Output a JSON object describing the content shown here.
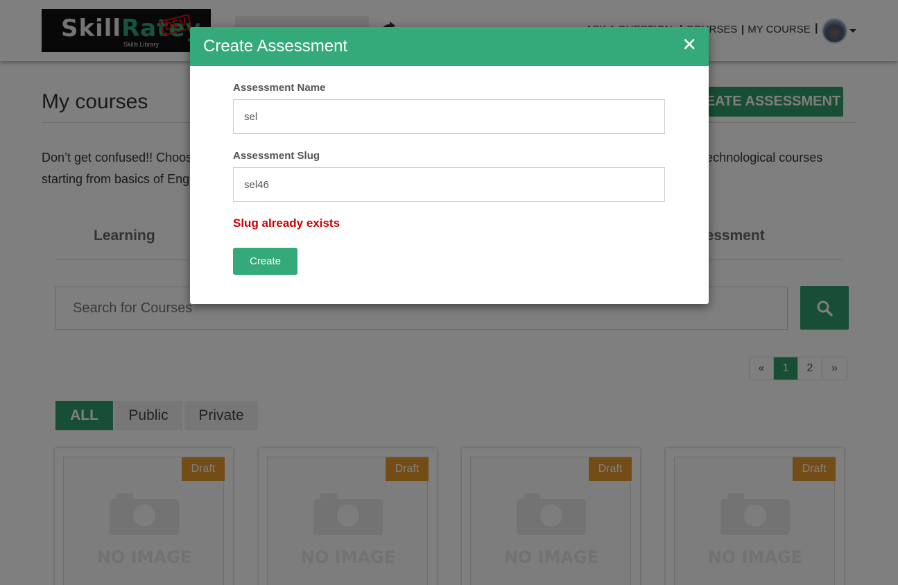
{
  "header": {
    "logo_text_a": "Skill",
    "logo_text_b": "Ratey",
    "logo_sub": "Skills Library",
    "logo_stamp": "DEV",
    "nav": {
      "ask_question": "ASK A QUESTION",
      "courses": "COURSES",
      "my_course": "MY COURSE",
      "separator": "|"
    }
  },
  "page": {
    "title": "My courses",
    "create_assessment_label": "CREATE ASSESSMENT",
    "description_start": "Don’t get confused!! Choos",
    "description_end": "technological courses",
    "description_line2": "starting from basics of Eng",
    "tabs": {
      "learning": "Learning",
      "assessment": "Assessment"
    },
    "search_placeholder": "Search for Courses",
    "pagination": [
      "«",
      "1",
      "2",
      "»"
    ],
    "active_page": "1",
    "filters": {
      "all": "ALL",
      "public": "Public",
      "private": "Private"
    },
    "cards": [
      {
        "badge": "Draft",
        "placeholder": "NO IMAGE"
      },
      {
        "badge": "Draft",
        "placeholder": "NO IMAGE"
      },
      {
        "badge": "Draft",
        "placeholder": "NO IMAGE"
      },
      {
        "badge": "Draft",
        "placeholder": "NO IMAGE"
      }
    ]
  },
  "modal": {
    "title": "Create Assessment",
    "close_symbol": "✕",
    "name_label": "Assessment Name",
    "name_value": "sel",
    "slug_label": "Assessment Slug",
    "slug_value": "sel46",
    "error_text": "Slug already exists",
    "create_label": "Create"
  },
  "colors": {
    "brand_green": "#2f9c6b",
    "modal_header": "#34a97a",
    "draft_badge": "#e79a2b",
    "error": "#cc0000"
  }
}
